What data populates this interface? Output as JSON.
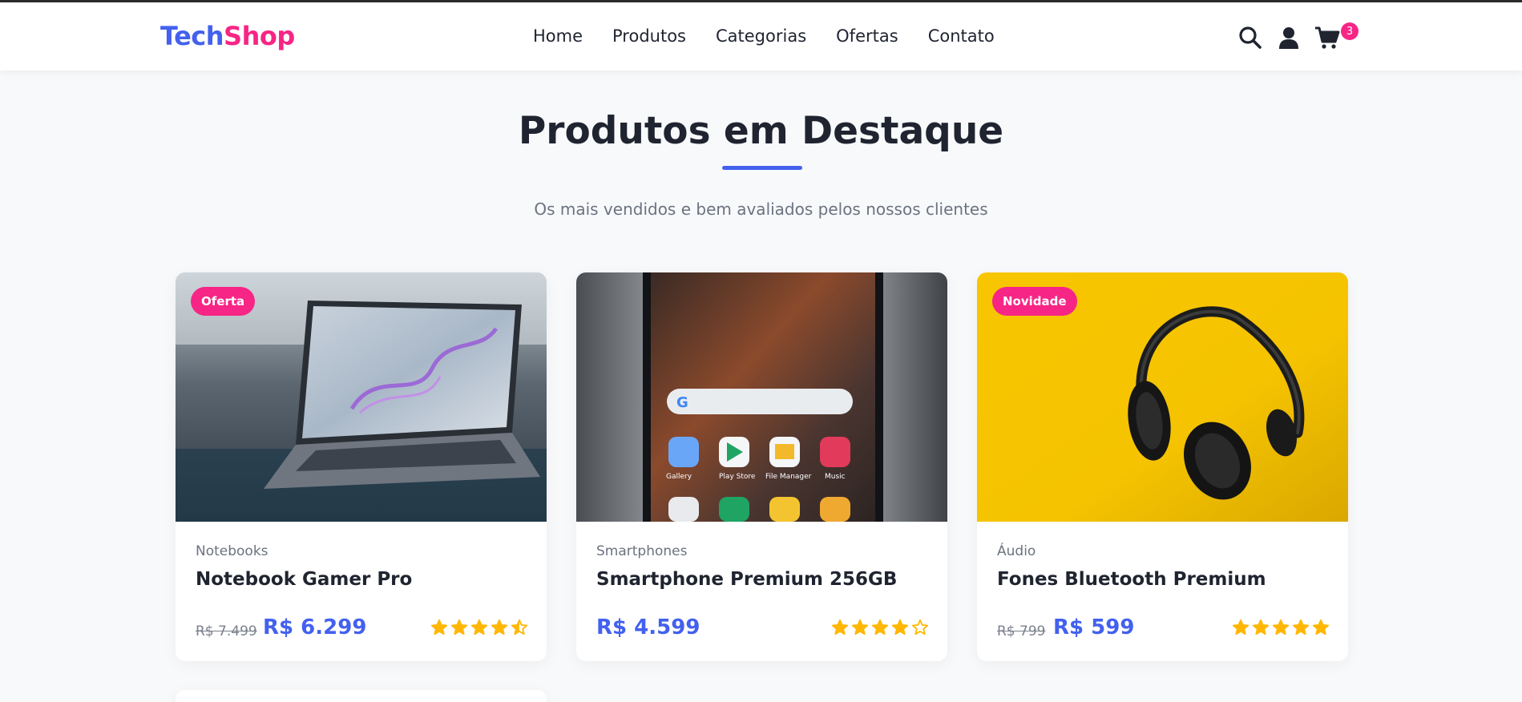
{
  "header": {
    "logo_part1": "Tech",
    "logo_part2": "Shop",
    "nav": [
      "Home",
      "Produtos",
      "Categorias",
      "Ofertas",
      "Contato"
    ],
    "cart_count": "3",
    "icons": [
      "search-icon",
      "user-icon",
      "cart-icon"
    ]
  },
  "hero": {
    "title": "Produtos em Destaque",
    "subtitle": "Os mais vendidos e bem avaliados pelos nossos clientes"
  },
  "products": [
    {
      "badge": "Oferta",
      "category": "Notebooks",
      "name": "Notebook Gamer Pro",
      "old_price": "R$ 7.499",
      "price": "R$ 6.299",
      "rating": 4.5
    },
    {
      "badge": "",
      "category": "Smartphones",
      "name": "Smartphone Premium 256GB",
      "old_price": "",
      "price": "R$ 4.599",
      "rating": 4
    },
    {
      "badge": "Novidade",
      "category": "Áudio",
      "name": "Fones Bluetooth Premium",
      "old_price": "R$ 799",
      "price": "R$ 599",
      "rating": 5
    }
  ],
  "colors": {
    "primary": "#4361ee",
    "accent": "#f72585",
    "star": "#ffb703",
    "background": "#f8f9fb"
  }
}
